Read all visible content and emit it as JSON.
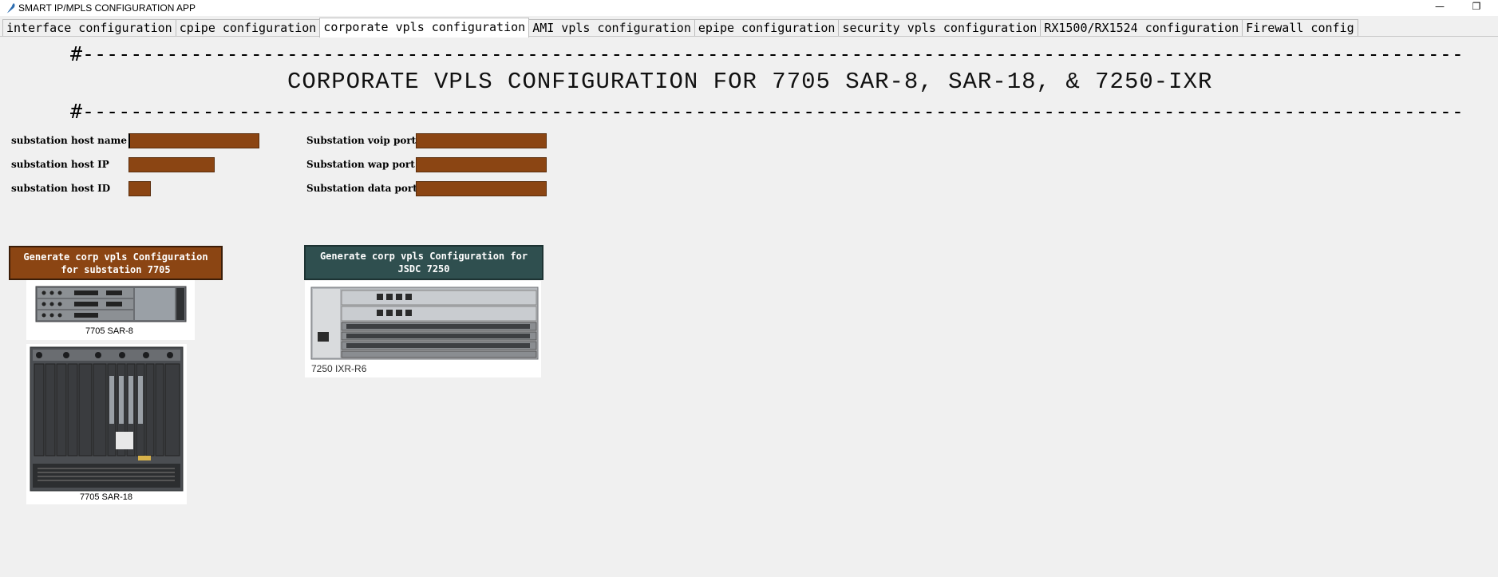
{
  "window": {
    "title": "SMART IP/MPLS CONFIGURATION APP",
    "minimize_glyph": "—",
    "restore_glyph": "❐"
  },
  "tabs": [
    {
      "label": "interface configuration",
      "active": false
    },
    {
      "label": "cpipe configuration",
      "active": false
    },
    {
      "label": "corporate vpls configuration",
      "active": true
    },
    {
      "label": "AMI vpls configuration",
      "active": false
    },
    {
      "label": "epipe configuration",
      "active": false
    },
    {
      "label": "security vpls configuration",
      "active": false
    },
    {
      "label": "RX1500/RX1524 configuration",
      "active": false
    },
    {
      "label": "Firewall config",
      "active": false
    }
  ],
  "banner": {
    "hash_line": "#------------------------------------------------------------------------------------------------------------------------",
    "title": "CORPORATE VPLS CONFIGURATION FOR 7705 SAR-8, SAR-18, & 7250-IXR"
  },
  "form": {
    "host_name_label": "substation host name",
    "host_name_value": "",
    "host_ip_label": "substation host IP",
    "host_ip_value": "",
    "host_id_label": "substation host ID",
    "host_id_value": "",
    "voip_port_label": "Substation voip port",
    "voip_port_value": "",
    "wap_port_label": "Substation wap port",
    "wap_port_value": "",
    "data_port_label": "Substation data port",
    "data_port_value": "",
    "field_color": "#8b4513"
  },
  "buttons": {
    "gen_7705": "Generate corp vpls Configuration for substation 7705",
    "gen_7250": "Generate corp vpls Configuration for JSDC 7250",
    "gen_7705_color": "#8b4513",
    "gen_7250_color": "#2f4f4f"
  },
  "devices": {
    "sar8_caption": "7705 SAR-8",
    "sar18_caption": "7705 SAR-18",
    "ixr_caption": "7250 IXR-R6"
  }
}
